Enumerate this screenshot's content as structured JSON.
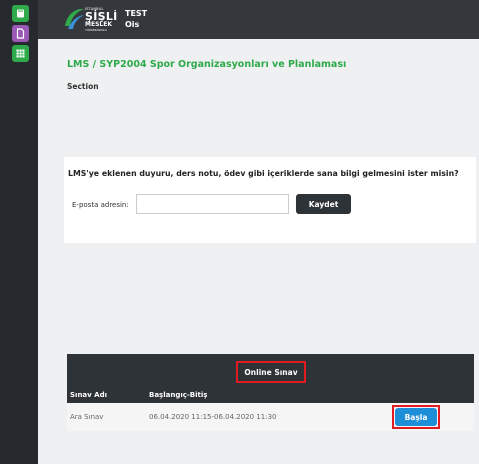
{
  "header": {
    "logo": {
      "line1": "İSTANBUL",
      "line2": "ŞİŞLİ",
      "line3": "MESLEK",
      "line4": "YÜKSEKOKULU"
    },
    "user_line1": "TEST",
    "user_line2": "Ois"
  },
  "sidebar": {
    "items": [
      {
        "icon": "book-icon",
        "color": "#2eaa4b"
      },
      {
        "icon": "document-icon",
        "color": "#9b59b6"
      },
      {
        "icon": "grid-icon",
        "color": "#2eaa4b"
      }
    ]
  },
  "main": {
    "breadcrumb": "LMS / SYP2004 Spor Organizasyonları ve Planlaması",
    "section_label": "Section"
  },
  "notify": {
    "question": "LMS'ye eklenen duyuru, ders notu, ödev gibi içeriklerde sana bilgi gelmesini ister misin?",
    "email_label": "E-posta adresin:",
    "email_value": "",
    "email_placeholder": "",
    "save_label": "Kaydet"
  },
  "exam": {
    "title": "Online Sınav",
    "columns": [
      "Sınav Adı",
      "Başlangıç-Bitiş"
    ],
    "rows": [
      {
        "name": "Ara Sınav",
        "range": "06.04.2020 11:15-06.04.2020 11:30",
        "action": "Başla"
      }
    ]
  },
  "colors": {
    "accent_green": "#2eaa4b",
    "dark": "#2e3338",
    "highlight_red": "#e21b22",
    "button_blue": "#1e8ed8"
  }
}
